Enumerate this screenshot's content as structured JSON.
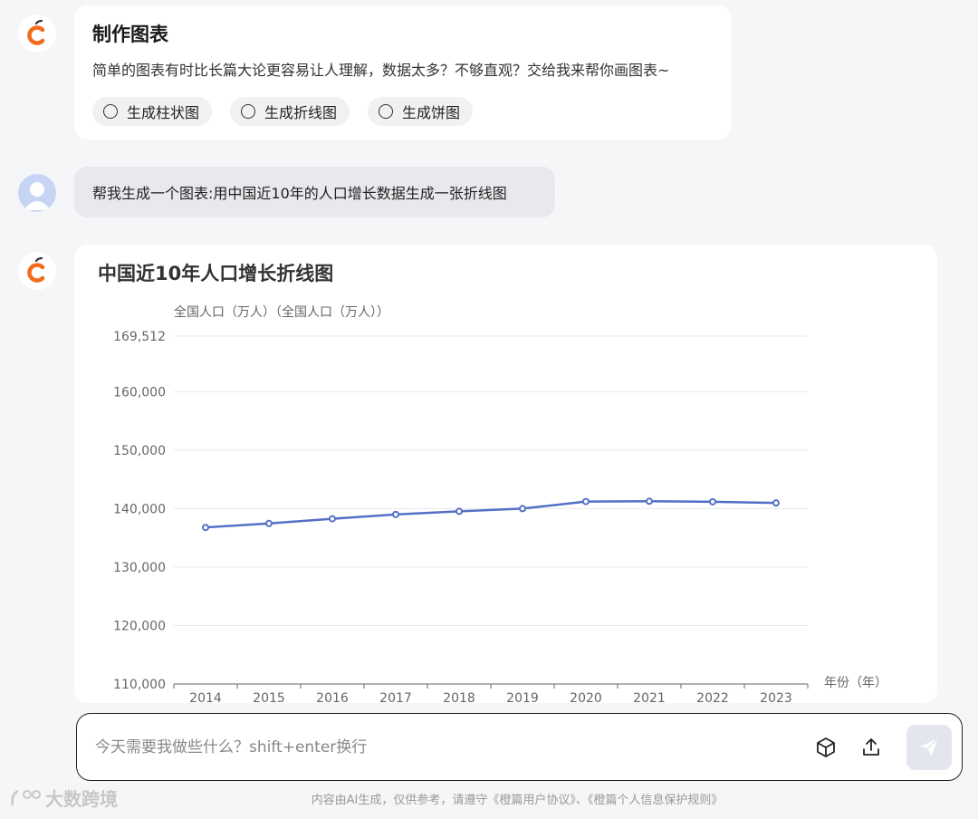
{
  "card1": {
    "title": "制作图表",
    "description": "简单的图表有时比长篇大论更容易让人理解，数据太多？不够直观？交给我来帮你画图表~",
    "options": [
      "生成柱状图",
      "生成折线图",
      "生成饼图"
    ]
  },
  "user_message": "帮我生成一个图表:用中国近10年的人口增长数据生成一张折线图",
  "chart_data": {
    "type": "line",
    "title": "中国近10年人口增长折线图",
    "ylabel": "全国人口（万人）（全国人口（万人））",
    "xlabel": "年份（年）",
    "categories": [
      "2014",
      "2015",
      "2016",
      "2017",
      "2018",
      "2019",
      "2020",
      "2021",
      "2022",
      "2023"
    ],
    "series": [
      {
        "values": [
          136782,
          137462,
          138271,
          139008,
          139538,
          140005,
          141212,
          141260,
          141175,
          140967
        ]
      }
    ],
    "ylim": [
      110000,
      169512
    ],
    "yticks": [
      "169,512",
      "160,000",
      "150,000",
      "140,000",
      "130,000",
      "120,000",
      "110,000"
    ],
    "grid": true,
    "color": "#5470c6"
  },
  "input": {
    "placeholder": "今天需要我做些什么？shift+enter换行"
  },
  "icons": {
    "bot": "orange-logo-icon",
    "user": "user-avatar-icon",
    "cube": "cube-icon",
    "upload": "upload-icon",
    "send": "send-icon"
  },
  "footer": "内容由AI生成，仅供参考，请遵守《橙篇用户协议》、《橙篇个人信息保护规则》",
  "watermark": "大数跨境"
}
